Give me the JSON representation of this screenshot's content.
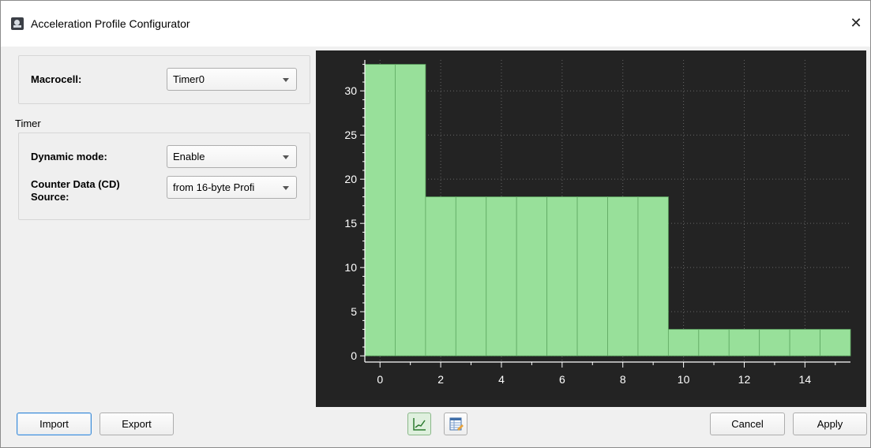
{
  "window": {
    "title": "Acceleration Profile Configurator",
    "close_glyph": "✕"
  },
  "macrocell": {
    "label": "Macrocell:",
    "value": "Timer0"
  },
  "timer": {
    "section_label": "Timer",
    "dynamic_mode": {
      "label": "Dynamic mode:",
      "value": "Enable"
    },
    "cd_source": {
      "label_line1": "Counter Data (CD)",
      "label_line2": "Source:",
      "value": "from 16-byte Profi"
    }
  },
  "buttons": {
    "import": "Import",
    "export": "Export",
    "cancel": "Cancel",
    "apply": "Apply"
  },
  "toolbar": {
    "chart_view_icon": "line-chart-icon",
    "table_view_icon": "table-icon"
  },
  "colors": {
    "bar_fill": "#98e09a",
    "bar_edge": "#5fa862",
    "plot_bg": "#232323",
    "grid": "#666666",
    "axis": "#ffffff"
  },
  "chart_data": {
    "type": "bar",
    "x": [
      0,
      1,
      2,
      3,
      4,
      5,
      6,
      7,
      8,
      9,
      10,
      11,
      12,
      13,
      14,
      15
    ],
    "values": [
      33,
      33,
      18,
      18,
      18,
      18,
      18,
      18,
      18,
      18,
      3,
      3,
      3,
      3,
      3,
      3
    ],
    "xticks": [
      "0",
      "2",
      "4",
      "6",
      "8",
      "10",
      "12",
      "14"
    ],
    "yticks": [
      "0",
      "5",
      "10",
      "15",
      "20",
      "25",
      "30"
    ],
    "xlim": [
      -0.5,
      15.5
    ],
    "ylim": [
      -0.7,
      33.5
    ],
    "grid": true,
    "title": "",
    "xlabel": "",
    "ylabel": ""
  }
}
